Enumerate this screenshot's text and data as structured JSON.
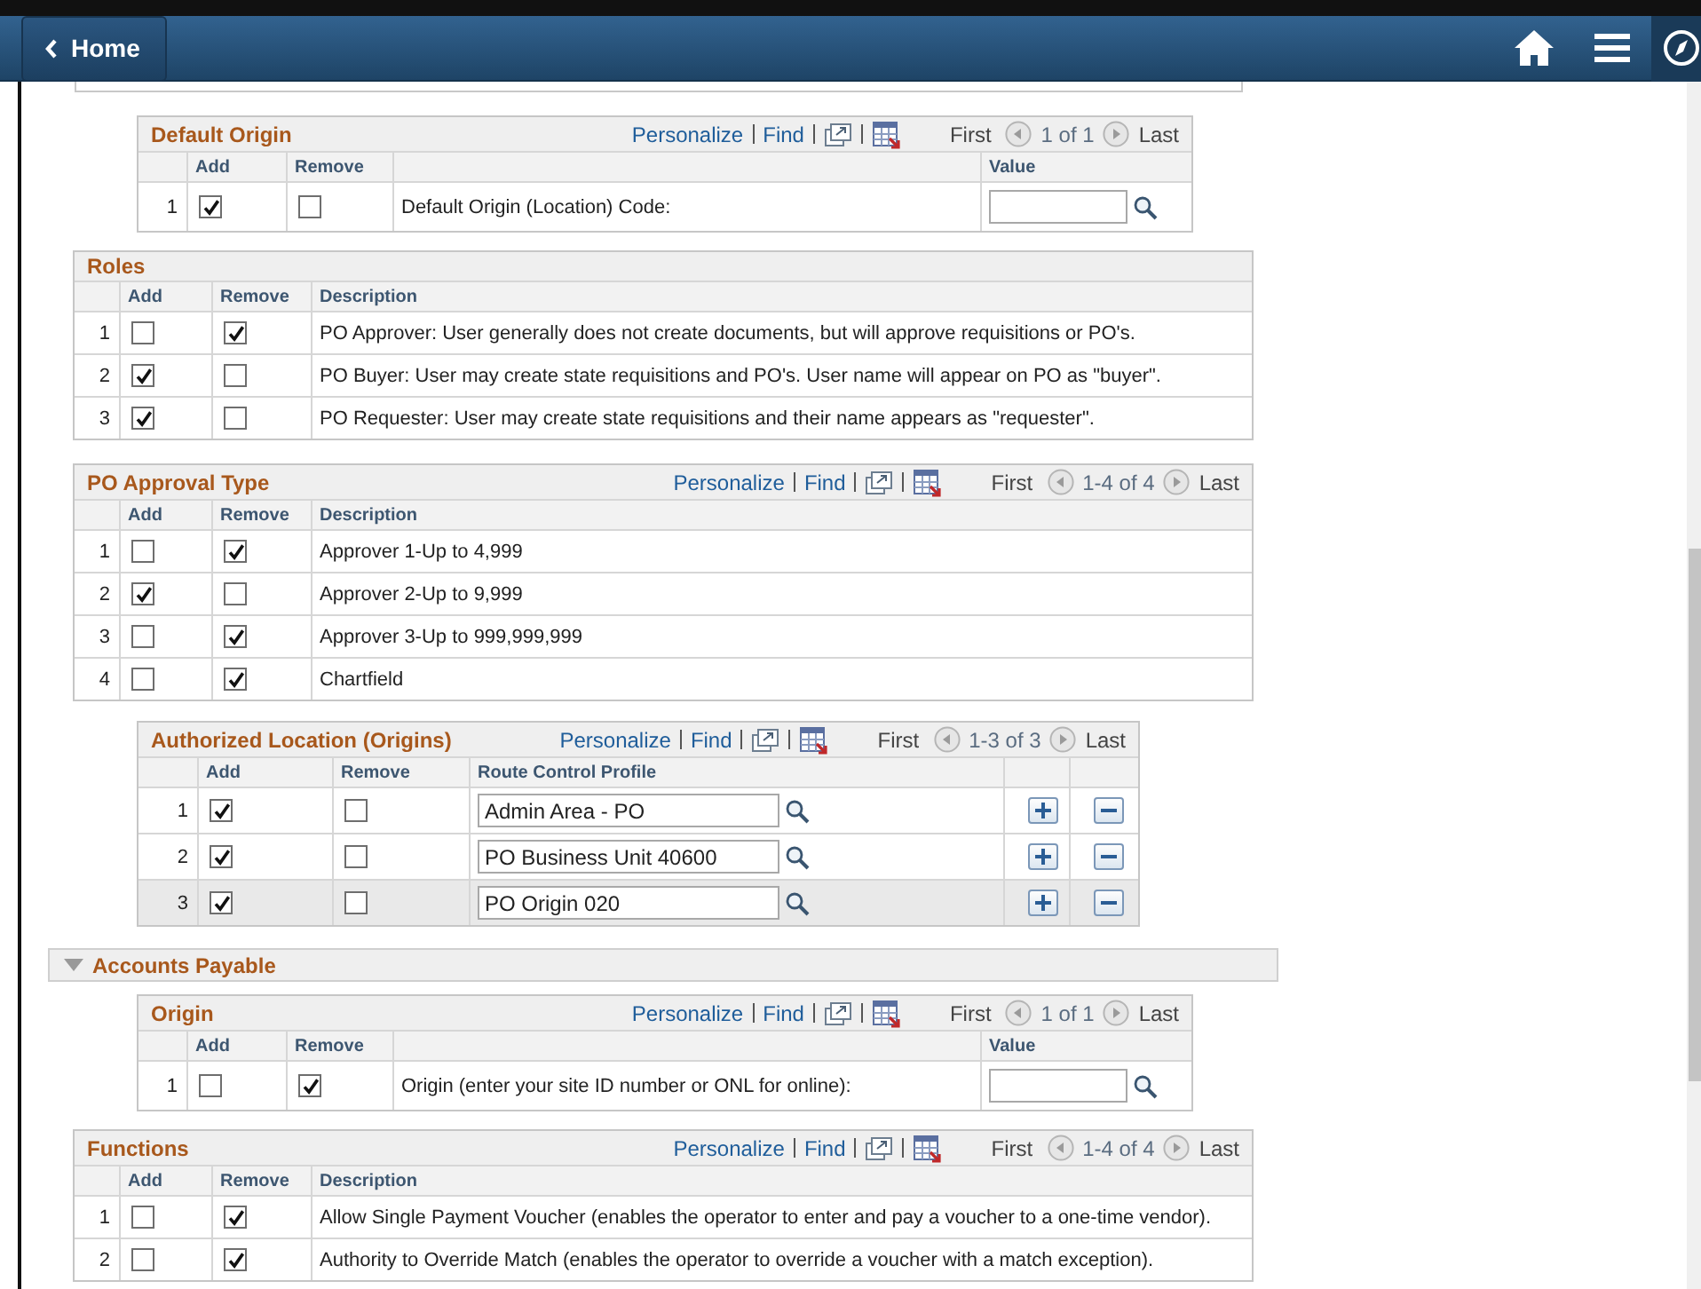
{
  "header": {
    "back_button": "Home"
  },
  "sections": [
    {
      "grids": [
        {
          "kind": "prompt",
          "title": "Default Origin",
          "nav": {
            "personalize": "Personalize",
            "find": "Find",
            "first": "First",
            "range": "1 of 1",
            "last": "Last"
          },
          "columns": [
            "Add",
            "Remove",
            "Value"
          ],
          "rows": [
            {
              "number": "1",
              "add": true,
              "remove": false,
              "label": "Default Origin (Location) Code:"
            }
          ]
        },
        {
          "kind": "list",
          "title": "Roles",
          "columns": [
            "Add",
            "Remove",
            "Description"
          ],
          "rows": [
            {
              "number": "1",
              "add": false,
              "remove": true,
              "label": "PO Approver:  User generally does not create documents, but will approve requisitions or PO's."
            },
            {
              "number": "2",
              "add": true,
              "remove": false,
              "label": "PO Buyer:  User may create state requisitions and PO's.  User name will appear on PO as \"buyer\"."
            },
            {
              "number": "3",
              "add": true,
              "remove": false,
              "label": "PO Requester:  User may create state requisitions and their name appears as \"requester\"."
            }
          ]
        },
        {
          "kind": "list",
          "title": "PO Approval Type",
          "nav": {
            "personalize": "Personalize",
            "find": "Find",
            "first": "First",
            "range": "1-4 of 4",
            "last": "Last"
          },
          "columns": [
            "Add",
            "Remove",
            "Description"
          ],
          "rows": [
            {
              "number": "1",
              "add": false,
              "remove": true,
              "label": "Approver 1-Up to 4,999"
            },
            {
              "number": "2",
              "add": true,
              "remove": false,
              "label": "Approver 2-Up to 9,999"
            },
            {
              "number": "3",
              "add": false,
              "remove": true,
              "label": "Approver 3-Up to 999,999,999"
            },
            {
              "number": "4",
              "add": false,
              "remove": true,
              "label": "Chartfield"
            }
          ]
        },
        {
          "kind": "route",
          "title": "Authorized Location (Origins)",
          "nav": {
            "personalize": "Personalize",
            "find": "Find",
            "first": "First",
            "range": "1-3 of 3",
            "last": "Last"
          },
          "columns": [
            "Add",
            "Remove",
            "Route Control Profile"
          ],
          "rows": [
            {
              "number": "1",
              "add": true,
              "remove": false,
              "value": "Admin Area - PO",
              "selected": false
            },
            {
              "number": "2",
              "add": true,
              "remove": false,
              "value": "PO Business Unit 40600",
              "selected": false
            },
            {
              "number": "3",
              "add": true,
              "remove": false,
              "value": "PO Origin 020",
              "selected": true
            }
          ]
        }
      ]
    },
    {
      "title": "Accounts Payable",
      "expanded": true,
      "grids": [
        {
          "kind": "prompt",
          "title": "Origin",
          "nav": {
            "personalize": "Personalize",
            "find": "Find",
            "first": "First",
            "range": "1 of 1",
            "last": "Last"
          },
          "columns": [
            "Add",
            "Remove",
            "Value"
          ],
          "rows": [
            {
              "number": "1",
              "add": false,
              "remove": true,
              "label": "Origin (enter your site ID number or ONL for online):"
            }
          ]
        },
        {
          "kind": "list",
          "title": "Functions",
          "nav": {
            "personalize": "Personalize",
            "find": "Find",
            "first": "First",
            "range": "1-4 of 4",
            "last": "Last"
          },
          "columns": [
            "Add",
            "Remove",
            "Description"
          ],
          "rows": [
            {
              "number": "1",
              "add": false,
              "remove": true,
              "label": "Allow Single Payment Voucher (enables the operator to enter and pay a voucher to a one-time vendor)."
            },
            {
              "number": "2",
              "add": false,
              "remove": true,
              "label": "Authority to Override Match (enables the operator to override a voucher with a match exception)."
            }
          ]
        }
      ]
    }
  ]
}
